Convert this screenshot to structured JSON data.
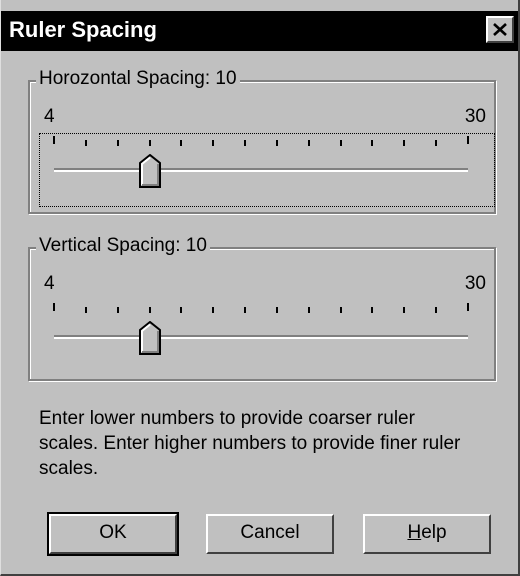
{
  "window": {
    "title": "Ruler Spacing",
    "close_icon": "close-icon"
  },
  "horizontal": {
    "label": "Horozontal Spacing: 10",
    "min_label": "4",
    "max_label": "30",
    "min": 4,
    "max": 30,
    "value": 10,
    "tick_count": 14
  },
  "vertical": {
    "label": "Vertical Spacing: 10",
    "min_label": "4",
    "max_label": "30",
    "min": 4,
    "max": 30,
    "value": 10,
    "tick_count": 14
  },
  "hint": "Enter lower numbers to provide coarser ruler scales.  Enter higher numbers to provide finer ruler scales.",
  "buttons": {
    "ok": "OK",
    "cancel": "Cancel",
    "help_mnemonic": "H",
    "help_rest": "elp"
  },
  "colors": {
    "face": "#c0c0c0",
    "titlebar": "#000000",
    "titletext": "#ffffff"
  }
}
